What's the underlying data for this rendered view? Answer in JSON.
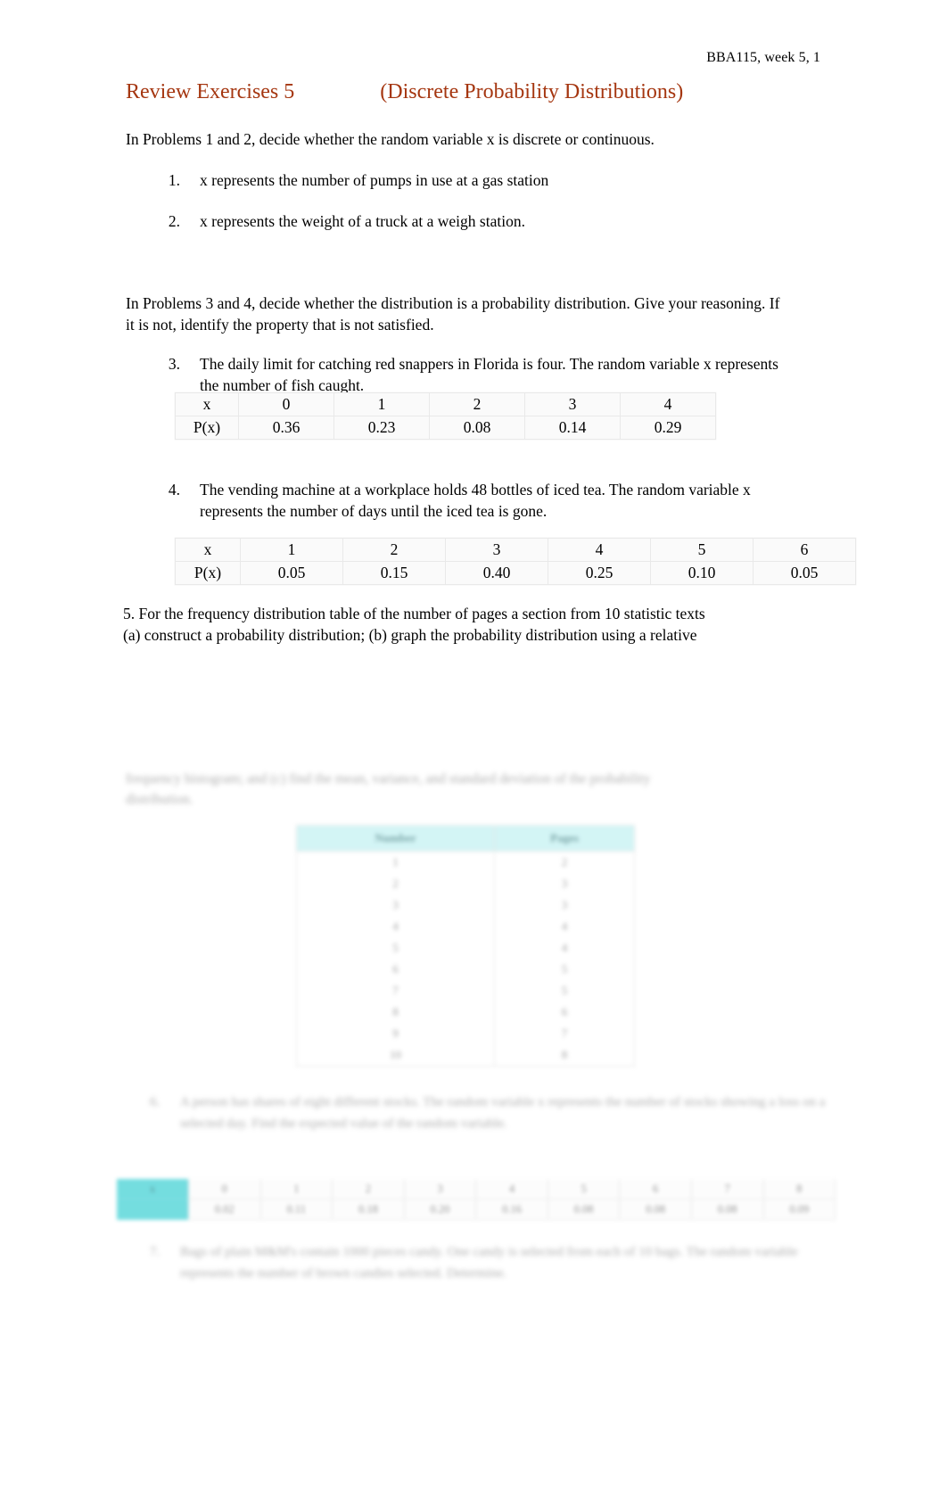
{
  "document": {
    "header": "BBA115, week 5, 1",
    "title_main": "Review Exercises 5",
    "title_sub": "(Discrete Probability Distributions)",
    "title_color": "#a53610"
  },
  "intro_1_2": "In Problems 1 and 2, decide whether the random variable x is discrete or continuous.",
  "items": [
    {
      "num": "1.",
      "text": "x represents the number of pumps in use at a gas station"
    },
    {
      "num": "2.",
      "text": "x represents the weight of a truck at a weigh station."
    }
  ],
  "intro_3_4": "In Problems 3 and 4, decide whether the distribution is a probability distribution. Give your reasoning. If it is not, identify the property that is not satisfied.",
  "item3": {
    "num": "3.",
    "text": "The daily limit for catching red snappers in Florida is four. The random variable x represents the number of fish caught.",
    "table": {
      "row_labels": [
        "x",
        "P(x)"
      ],
      "x": [
        "0",
        "1",
        "2",
        "3",
        "4"
      ],
      "px": [
        "0.36",
        "0.23",
        "0.08",
        "0.14",
        "0.29"
      ]
    }
  },
  "item4": {
    "num": "4.",
    "text": "The vending machine at a workplace holds 48 bottles of iced tea. The random variable x represents the number of days until the iced tea is gone.",
    "table": {
      "row_labels": [
        "x",
        "P(x)"
      ],
      "x": [
        "1",
        "2",
        "3",
        "4",
        "5",
        "6"
      ],
      "px": [
        "0.05",
        "0.15",
        "0.40",
        "0.25",
        "0.10",
        "0.05"
      ]
    }
  },
  "item5": {
    "line1": "5. For the frequency distribution table of the number of pages a section from 10 statistic texts",
    "line2": " (a) construct a probability distribution; (b) graph the probability distribution using a relative"
  },
  "blurred_region": {
    "note_line1": "frequency histogram; and (c) find the mean, variance, and standard deviation of the probability",
    "note_line2": "distribution.",
    "table_headers": [
      "Number",
      "Pages"
    ],
    "table_col1": [
      "1",
      "2",
      "3",
      "4",
      "5",
      "6",
      "7",
      "8",
      "9",
      "10"
    ],
    "table_col2": [
      "2",
      "3",
      "3",
      "4",
      "4",
      "5",
      "5",
      "6",
      "7",
      "8"
    ],
    "item6": {
      "num": "6.",
      "text": "A person has shares of eight different stocks. The random variable x represents the number of stocks showing a loss on a selected day. Find the expected value of the random variable."
    },
    "strip_label": "x",
    "strip_values": [
      "0",
      "1",
      "2",
      "3",
      "4",
      "5",
      "6",
      "7",
      "8"
    ],
    "strip_probs": [
      "0.02",
      "0.11",
      "0.18",
      "0.20",
      "0.16",
      "0.08",
      "0.08",
      "0.08",
      "0.09"
    ],
    "item7": {
      "num": "7.",
      "text": "Bags of plain M&M's contain 1000 pieces candy. One candy is selected from each of 10 bags. The random variable represents the number of brown candies selected. Determine."
    }
  },
  "colors": {
    "teal_header": "#b9eff0",
    "teal_accent": "#3fd0d4",
    "table_fill": "#fafafa"
  }
}
